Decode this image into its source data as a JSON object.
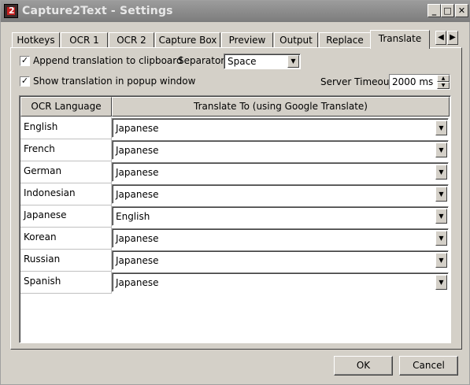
{
  "window": {
    "title": "Capture2Text - Settings",
    "controls": {
      "minimize": "_",
      "maximize": "□",
      "close": "✕"
    }
  },
  "tabs": [
    {
      "label": "Hotkeys",
      "active": false
    },
    {
      "label": "OCR 1",
      "active": false
    },
    {
      "label": "OCR 2",
      "active": false
    },
    {
      "label": "Capture Box",
      "active": false
    },
    {
      "label": "Preview",
      "active": false
    },
    {
      "label": "Output",
      "active": false
    },
    {
      "label": "Replace",
      "active": false
    },
    {
      "label": "Translate",
      "active": true
    }
  ],
  "tab_scroll": {
    "left": "◀",
    "right": "▶"
  },
  "options": {
    "append_translation": {
      "label": "Append translation to clipboard",
      "checked": true
    },
    "separator": {
      "label": "Separator:",
      "value": "Space"
    },
    "show_popup": {
      "label": "Show translation in popup window",
      "checked": true
    },
    "server_timeout": {
      "label": "Server Timeout:",
      "value": "2000 ms"
    }
  },
  "check_glyph": "✓",
  "dropdown_glyph": "▼",
  "spin_glyphs": {
    "up": "▲",
    "down": "▼"
  },
  "table": {
    "headers": [
      "OCR Language",
      "Translate To (using Google Translate)"
    ],
    "rows": [
      {
        "language": "English",
        "translate_to": "Japanese"
      },
      {
        "language": "French",
        "translate_to": "Japanese"
      },
      {
        "language": "German",
        "translate_to": "Japanese"
      },
      {
        "language": "Indonesian",
        "translate_to": "Japanese"
      },
      {
        "language": "Japanese",
        "translate_to": "English"
      },
      {
        "language": "Korean",
        "translate_to": "Japanese"
      },
      {
        "language": "Russian",
        "translate_to": "Japanese"
      },
      {
        "language": "Spanish",
        "translate_to": "Japanese"
      }
    ]
  },
  "buttons": {
    "ok": "OK",
    "cancel": "Cancel"
  }
}
